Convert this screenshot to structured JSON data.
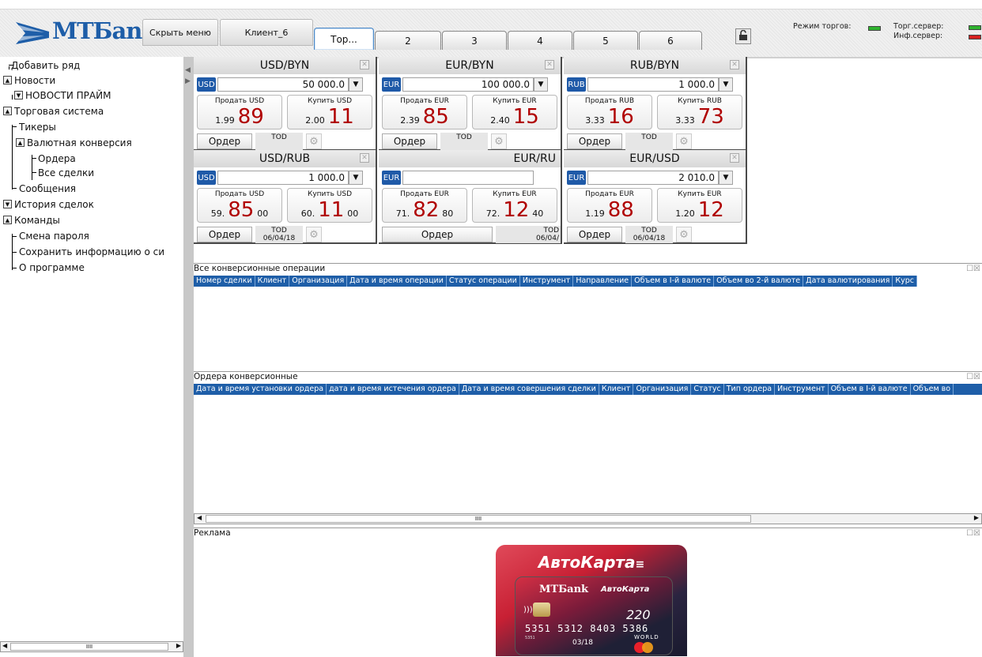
{
  "header": {
    "logo_text": "МТБank",
    "hide_menu_label": "Скрыть меню",
    "client_label": "Клиент_6",
    "tabs": [
      "Тор...",
      "2",
      "3",
      "4",
      "5",
      "6"
    ],
    "trade_mode_label": "Режим торгов:",
    "trade_server_label": "Торг.сервер:",
    "info_server_label": "Инф.сервер:",
    "colors": {
      "trade_mode": "#2fb32f",
      "trade_server": "#2fb32f",
      "info_server": "#d62020"
    }
  },
  "sidebar": {
    "items": [
      "Добавить ряд",
      "Новости",
      "НОВОСТИ ПРАЙМ",
      "Торговая система",
      "Тикеры",
      "Валютная конверсия",
      "Ордера",
      "Все сделки",
      "Сообщения",
      "История сделок",
      "Команды",
      "Смена пароля",
      "Сохранить информацию о си",
      "О программе"
    ],
    "scroll_thumb": "IIII"
  },
  "quotes": [
    {
      "pair": "USD/BYN",
      "currency": "USD",
      "amount": "50 000.0",
      "sell_label": "Продать USD",
      "buy_label": "Купить USD",
      "sell_small": "1.99",
      "sell_big": "89",
      "buy_small": "2.00",
      "buy_big": "11",
      "order": "Ордер",
      "tod": "TOD"
    },
    {
      "pair": "EUR/BYN",
      "currency": "EUR",
      "amount": "100 000.0",
      "sell_label": "Продать EUR",
      "buy_label": "Купить EUR",
      "sell_small": "2.39",
      "sell_big": "85",
      "buy_small": "2.40",
      "buy_big": "15",
      "order": "Ордер",
      "tod": "TOD"
    },
    {
      "pair": "RUB/BYN",
      "currency": "RUB",
      "amount": "1 000.0",
      "sell_label": "Продать RUB",
      "buy_label": "Купить RUB",
      "sell_small": "3.33",
      "sell_big": "16",
      "buy_small": "3.33",
      "buy_big": "73",
      "order": "Ордер",
      "tod": "TOD"
    },
    {
      "pair": "USD/RUB",
      "currency": "USD",
      "amount": "1 000.0",
      "sell_label": "Продать USD",
      "buy_label": "Купить USD",
      "sell_small": "59.",
      "sell_big": "85",
      "sell_tail": "00",
      "buy_small": "60.",
      "buy_big": "11",
      "buy_tail": "00",
      "order": "Ордер",
      "tod": "TOD",
      "date": "06/04/18"
    },
    {
      "pair": "EUR/RU",
      "currency": "EUR",
      "amount": "",
      "sell_label": "Продать EUR",
      "buy_label": "Купить EUR",
      "sell_small": "71.",
      "sell_big": "82",
      "sell_tail": "80",
      "buy_small": "72.",
      "buy_big": "12",
      "buy_tail": "40",
      "order": "Ордер",
      "tod": "TOD",
      "date": "06/04/"
    },
    {
      "pair": "EUR/USD",
      "currency": "EUR",
      "amount": "2 010.0",
      "sell_label": "Продать EUR",
      "buy_label": "Купить EUR",
      "sell_small": "1.19",
      "sell_big": "88",
      "buy_small": "1.20",
      "buy_big": "12",
      "order": "Ордер",
      "tod": "TOD",
      "date": "06/04/18"
    }
  ],
  "conversions_panel": {
    "title": "Все конверсионные операции",
    "columns": [
      "Номер сделки",
      "Клиент",
      "Организация",
      "Дата и время операции",
      "Статус операции",
      "Инструмент",
      "Направление",
      "Объем в I-й валюте",
      "Объем во 2-й валюте",
      "Дата валютирования",
      "Курс"
    ]
  },
  "orders_panel": {
    "title": "Ордера конверсионные",
    "columns": [
      "Дата и время установки ордера",
      "дата и время истечения ордера",
      "Дата и время совершения сделки",
      "Клиент",
      "Организация",
      "Статус",
      "Тип ордера",
      "Инструмент",
      "Объем в I-й валюте",
      "Объем во"
    ],
    "scroll_thumb": "IIII"
  },
  "ad_panel": {
    "title": "Реклама",
    "card_brand": "АвтоКарта",
    "card_bank": "МТБank",
    "card_inner_brand": "АвтоКарта",
    "card_number": "5351 5312 8403 5386",
    "card_small": "5351",
    "card_expiry": "03/18",
    "card_world": "WORLD"
  }
}
